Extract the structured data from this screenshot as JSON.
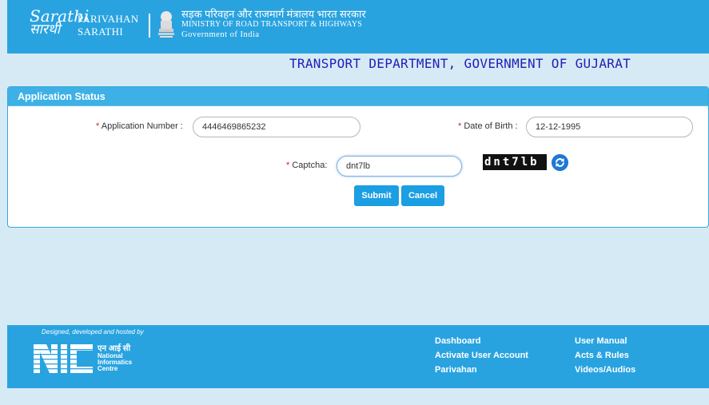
{
  "header": {
    "sarathi_logo_text": "Sarathi",
    "parivahan_line1": "PARIVAHAN",
    "parivahan_line2": "SARATHI",
    "ministry_hindi": "सड़क परिवहन और राजमार्ग मंत्रालय भारत सरकार",
    "ministry_english": "MINISTRY OF ROAD TRANSPORT & HIGHWAYS",
    "government": "Government of India"
  },
  "department_title": "TRANSPORT DEPARTMENT, GOVERNMENT OF GUJARAT",
  "panel": {
    "title": "Application Status",
    "required_marker": "*",
    "application_number_label": "Application Number :",
    "application_number_value": "4446469865232",
    "dob_label": "Date of Birth :",
    "dob_value": "12-12-1995",
    "captcha_label": "Captcha:",
    "captcha_value": "dnt7lb",
    "captcha_image_text": "dnt7lb",
    "submit_label": "Submit",
    "cancel_label": "Cancel"
  },
  "footer": {
    "designed_by": "Designed, developed and hosted by",
    "nic_hindi": "एन आई सी",
    "nic_line1": "National",
    "nic_line2": "Informatics",
    "nic_line3": "Centre",
    "links_col1": [
      "Dashboard",
      "Activate User Account",
      "Parivahan"
    ],
    "links_col2": [
      "User Manual",
      "Acts & Rules",
      "Videos/Audios"
    ]
  },
  "icons": {
    "refresh": "refresh-icon",
    "emblem": "national-emblem-icon"
  },
  "colors": {
    "header_bg": "#29a3e0",
    "page_bg": "#d6eaf5",
    "panel_head": "#3db1e6",
    "button": "#1b9ee2",
    "title_text": "#1d1fb8",
    "required": "#d32020"
  }
}
